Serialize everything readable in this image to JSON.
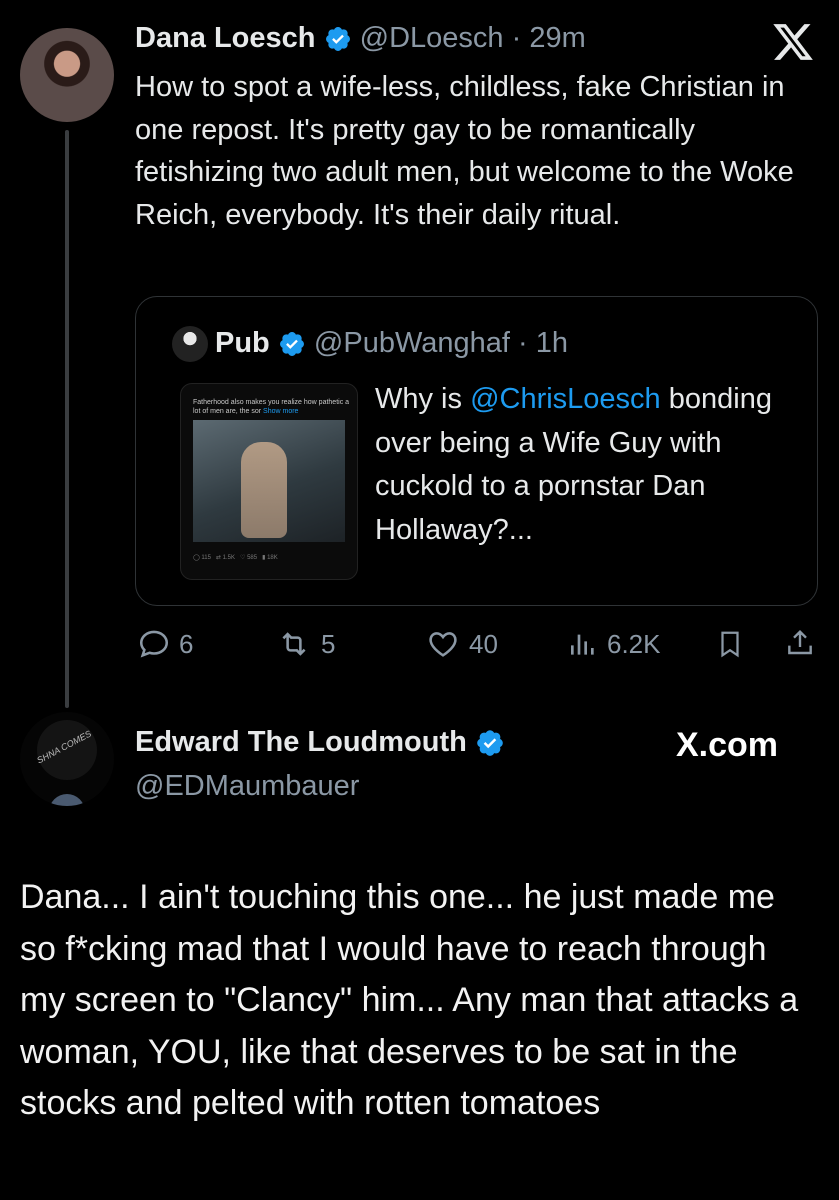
{
  "tweet1": {
    "name": "Dana Loesch",
    "handle": "@DLoesch",
    "time": "29m",
    "body": "How to spot a wife-less, childless, fake Christian in one repost. It's pretty gay to be romantically fetishizing two adult men, but welcome to the Woke Reich, everybody. It's their daily ritual.",
    "quote": {
      "name": "Pub",
      "handle": "@PubWanghaf",
      "time": "1h",
      "text_prefix": "Why is ",
      "mention": "@ChrisLoesch",
      "text_suffix": " bonding over being a Wife Guy with cuckold to a pornstar Dan Hollaway?...",
      "thumbnail": {
        "caption": "Fatherhood also makes you realize how pathetic a lot of men are, the sor",
        "show_more": "Show more",
        "stats": [
          "115",
          "1.5K",
          "585",
          "18K"
        ]
      }
    },
    "actions": {
      "replies": "6",
      "reposts": "5",
      "likes": "40",
      "views": "6.2K"
    }
  },
  "tweet2": {
    "name": "Edward The Loudmouth",
    "handle": "@EDMaumbauer",
    "avatar_text": "SHNA COMES",
    "body": "Dana... I ain't touching this one... he just made me so f*cking mad that I would have to reach through my screen to \"Clancy\" him... Any man that attacks a woman, YOU, like that deserves to be sat in the stocks and pelted with rotten tomatoes"
  },
  "watermark": "X.com",
  "colors": {
    "background": "#000000",
    "text": "#e7e9ea",
    "muted": "#8b98a5",
    "accent": "#1d9bf0"
  }
}
